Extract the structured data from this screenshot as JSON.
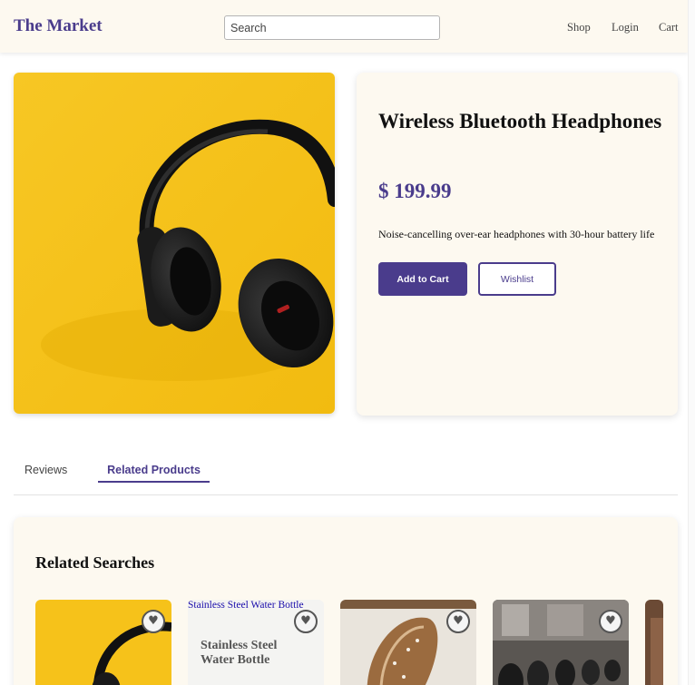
{
  "header": {
    "brand": "The Market",
    "search_placeholder": "Search",
    "nav": [
      "Shop",
      "Login",
      "Cart"
    ]
  },
  "product": {
    "image_icon": "headphones-photo",
    "title": "Wireless Bluetooth Headphones",
    "price": "$ 199.99",
    "description": "Noise-cancelling over-ear headphones with 30-hour battery life",
    "add_to_cart": "Add to Cart",
    "wishlist": "Wishlist"
  },
  "tabs": [
    "Reviews",
    "Related Products"
  ],
  "active_tab": "Related Products",
  "related": {
    "title": "Related Searches",
    "cards": [
      {
        "image": "headphones-photo",
        "broken_alt": "",
        "name": ""
      },
      {
        "image": "broken-image",
        "broken_alt": "Stainless Steel Water Bottle",
        "name": "Stainless Steel Water Bottle"
      },
      {
        "image": "bread-photo",
        "broken_alt": "",
        "name": ""
      },
      {
        "image": "gym-dumbbells-photo",
        "broken_alt": "",
        "name": ""
      }
    ],
    "heart_icon": "♥"
  },
  "colors": {
    "accent": "#4a3c8c",
    "header_bg": "#fdf9f0",
    "product_bg": "#f6c21a"
  }
}
